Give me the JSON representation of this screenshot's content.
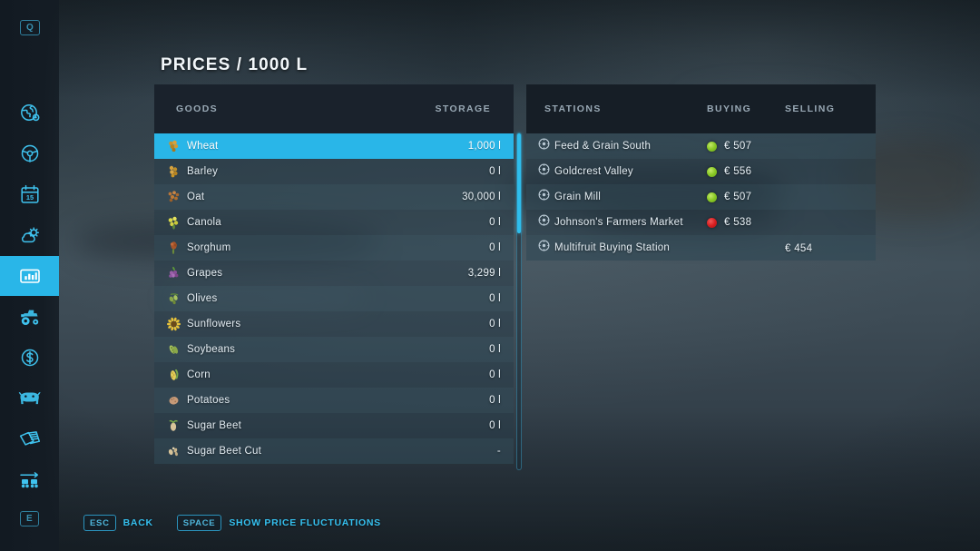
{
  "page": {
    "title": "PRICES / 1000 L"
  },
  "sidebar": {
    "top_key": "Q",
    "bottom_key": "E",
    "items": [
      {
        "name": "map",
        "icon": "globe-map-icon",
        "active": false
      },
      {
        "name": "vehicles",
        "icon": "steering-wheel-icon",
        "active": false
      },
      {
        "name": "calendar",
        "icon": "calendar-icon",
        "active": false,
        "day": "15"
      },
      {
        "name": "weather",
        "icon": "weather-icon",
        "active": false
      },
      {
        "name": "prices",
        "icon": "statistics-icon",
        "active": true
      },
      {
        "name": "machines",
        "icon": "tractor-icon",
        "active": false
      },
      {
        "name": "finances",
        "icon": "dollar-icon",
        "active": false
      },
      {
        "name": "animals",
        "icon": "cow-icon",
        "active": false
      },
      {
        "name": "contracts",
        "icon": "documents-icon",
        "active": false
      },
      {
        "name": "production",
        "icon": "production-icon",
        "active": false
      }
    ]
  },
  "goods_panel": {
    "columns": {
      "name": "GOODS",
      "storage": "STORAGE"
    },
    "rows": [
      {
        "label": "Wheat",
        "storage": "1,000 l",
        "icon": "wheat-icon",
        "selected": true
      },
      {
        "label": "Barley",
        "storage": "0 l",
        "icon": "barley-icon",
        "selected": false
      },
      {
        "label": "Oat",
        "storage": "30,000 l",
        "icon": "oat-icon",
        "selected": false
      },
      {
        "label": "Canola",
        "storage": "0 l",
        "icon": "canola-icon",
        "selected": false
      },
      {
        "label": "Sorghum",
        "storage": "0 l",
        "icon": "sorghum-icon",
        "selected": false
      },
      {
        "label": "Grapes",
        "storage": "3,299 l",
        "icon": "grapes-icon",
        "selected": false
      },
      {
        "label": "Olives",
        "storage": "0 l",
        "icon": "olives-icon",
        "selected": false
      },
      {
        "label": "Sunflowers",
        "storage": "0 l",
        "icon": "sunflower-icon",
        "selected": false
      },
      {
        "label": "Soybeans",
        "storage": "0 l",
        "icon": "soybean-icon",
        "selected": false
      },
      {
        "label": "Corn",
        "storage": "0 l",
        "icon": "corn-icon",
        "selected": false
      },
      {
        "label": "Potatoes",
        "storage": "0 l",
        "icon": "potato-icon",
        "selected": false
      },
      {
        "label": "Sugar Beet",
        "storage": "0 l",
        "icon": "sugarbeet-icon",
        "selected": false
      },
      {
        "label": "Sugar Beet Cut",
        "storage": "-",
        "icon": "sugarbeetcut-icon",
        "selected": false
      }
    ]
  },
  "stations_panel": {
    "columns": {
      "name": "STATIONS",
      "buying": "BUYING",
      "selling": "SELLING"
    },
    "rows": [
      {
        "label": "Feed & Grain South",
        "buying": "€ 507",
        "selling": "",
        "trend": "up"
      },
      {
        "label": "Goldcrest Valley",
        "buying": "€ 556",
        "selling": "",
        "trend": "up"
      },
      {
        "label": "Grain Mill",
        "buying": "€ 507",
        "selling": "",
        "trend": "up"
      },
      {
        "label": "Johnson's Farmers Market",
        "buying": "€ 538",
        "selling": "",
        "trend": "down"
      },
      {
        "label": "Multifruit Buying Station",
        "buying": "",
        "selling": "€ 454",
        "trend": "none"
      }
    ]
  },
  "bottom_bar": {
    "hints": [
      {
        "key": "ESC",
        "label": "BACK"
      },
      {
        "key": "SPACE",
        "label": "SHOW PRICE FLUCTUATIONS"
      }
    ]
  },
  "colors": {
    "accent": "#29b6e8",
    "accent_bright": "#2fbdec",
    "panel_header": "#1a222c",
    "row": "#31484f",
    "trend_up": "#8ac926",
    "trend_down": "#d81e20",
    "hint_text": "#35c0ef"
  }
}
